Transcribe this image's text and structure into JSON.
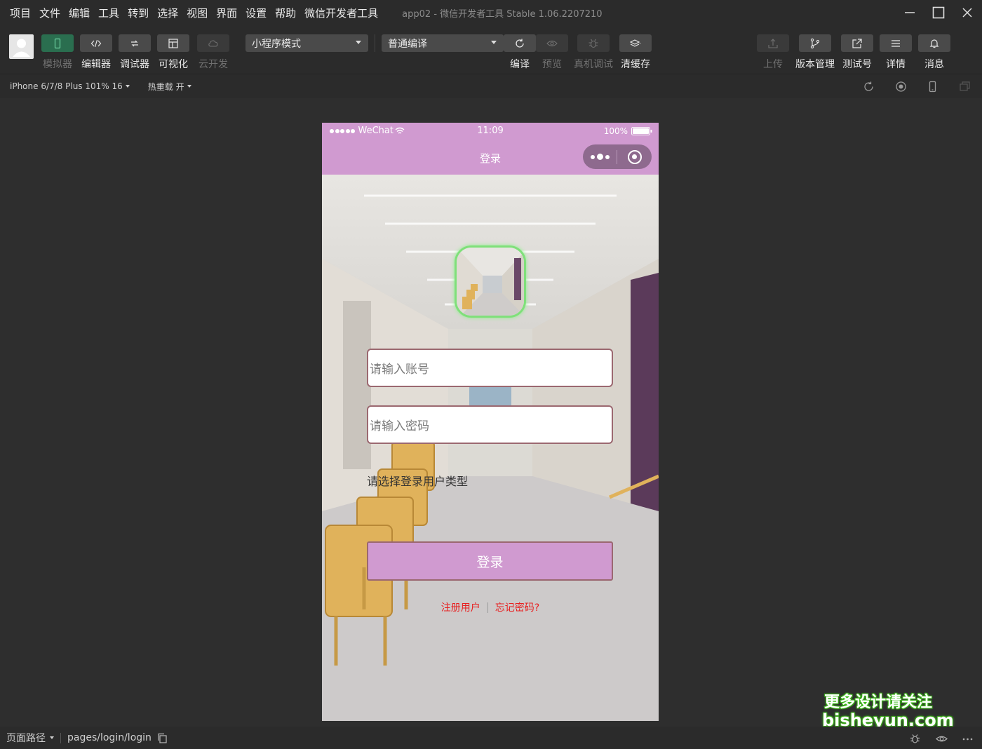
{
  "menu": [
    "项目",
    "文件",
    "编辑",
    "工具",
    "转到",
    "选择",
    "视图",
    "界面",
    "设置",
    "帮助",
    "微信开发者工具"
  ],
  "window_title": "app02 - 微信开发者工具 Stable 1.06.2207210",
  "toolbar": {
    "simulator": "模拟器",
    "editor": "编辑器",
    "debugger": "调试器",
    "visual": "可视化",
    "cloud": "云开发",
    "mode_select": "小程序模式",
    "compile_select": "普通编译",
    "compile": "编译",
    "preview": "预览",
    "remote_debug": "真机调试",
    "clear_cache": "清缓存",
    "upload": "上传",
    "version": "版本管理",
    "test_account": "测试号",
    "details": "详情",
    "messages": "消息"
  },
  "subbar": {
    "device": "iPhone 6/7/8 Plus 101% 16",
    "hot_reload": "热重载 开"
  },
  "phone": {
    "carrier": "WeChat",
    "time": "11:09",
    "battery": "100%",
    "nav_title": "登录",
    "account_placeholder": "请输入账号",
    "password_placeholder": "请输入密码",
    "user_type_prompt": "请选择登录用户类型",
    "login_button": "登录",
    "register_link": "注册用户",
    "forgot_link": "忘记密码?"
  },
  "bottom": {
    "page_path_label": "页面路径",
    "page_path": "pages/login/login"
  },
  "watermark": {
    "line1": "更多设计请关注",
    "line2": "bisheyun.com"
  },
  "colors": {
    "theme": "#d09ad0",
    "border": "#9b6870",
    "link": "#e81f1f",
    "active_btn": "#2a6e4f"
  }
}
